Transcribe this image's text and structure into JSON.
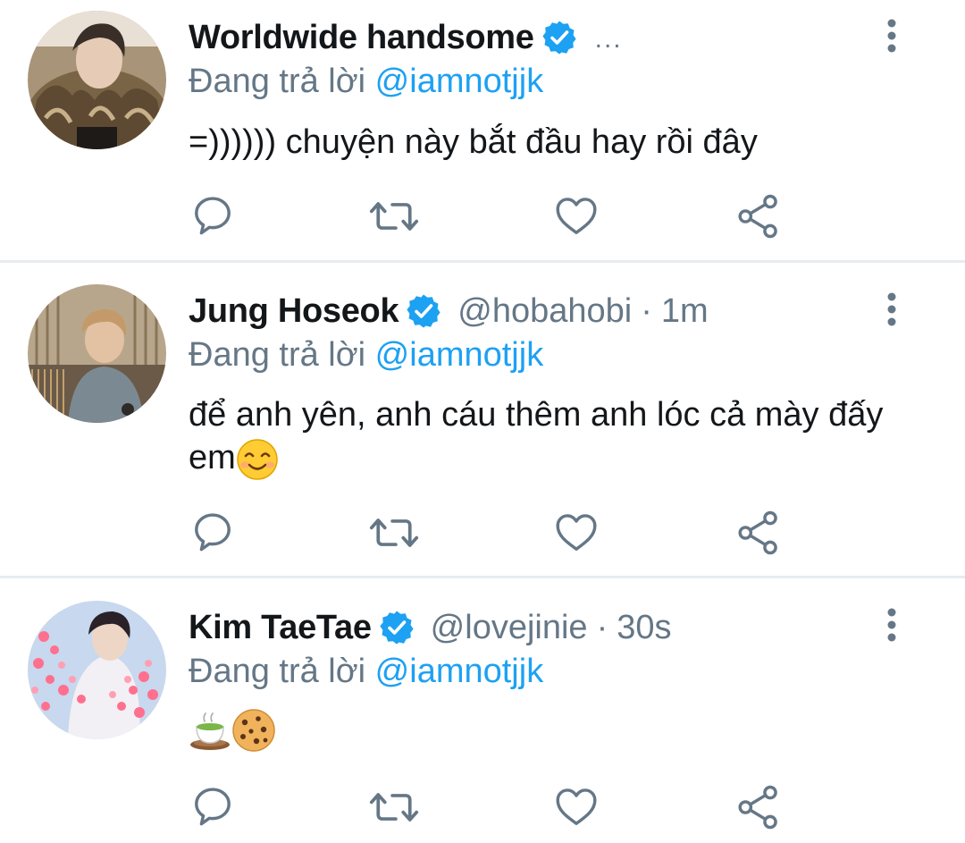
{
  "colors": {
    "text": "#14171a",
    "secondary": "#657786",
    "accent": "#1da1f2",
    "verified": "#1da1f2",
    "divider": "#e6ecf0"
  },
  "tweets": [
    {
      "name": "Worldwide handsome",
      "verified": true,
      "handle": "",
      "time": "",
      "truncated": "...",
      "reply_prefix": "Đang trả lời",
      "reply_to": "@iamnotjjk",
      "text": "=)))))) chuyện này bắt đầu hay rồi đây",
      "avatar_icon": "avatar-fur-coat"
    },
    {
      "name": "Jung Hoseok",
      "verified": true,
      "handle": "@hobahobi",
      "separator": "·",
      "time": "1m",
      "reply_prefix": "Đang trả lời",
      "reply_to": "@iamnotjjk",
      "text": "để anh yên, anh cáu thêm anh lóc cả mày đấy em",
      "emoji": "smiling-face-icon",
      "avatar_icon": "avatar-records"
    },
    {
      "name": "Kim TaeTae",
      "verified": true,
      "handle": "@lovejinie",
      "separator": "·",
      "time": "30s",
      "reply_prefix": "Đang trả lời",
      "reply_to": "@iamnotjjk",
      "text": "",
      "emojis": [
        "tea-icon",
        "cookie-icon"
      ],
      "avatar_icon": "avatar-hearts"
    }
  ],
  "actions": [
    "reply-icon",
    "retweet-icon",
    "like-icon",
    "share-icon"
  ]
}
